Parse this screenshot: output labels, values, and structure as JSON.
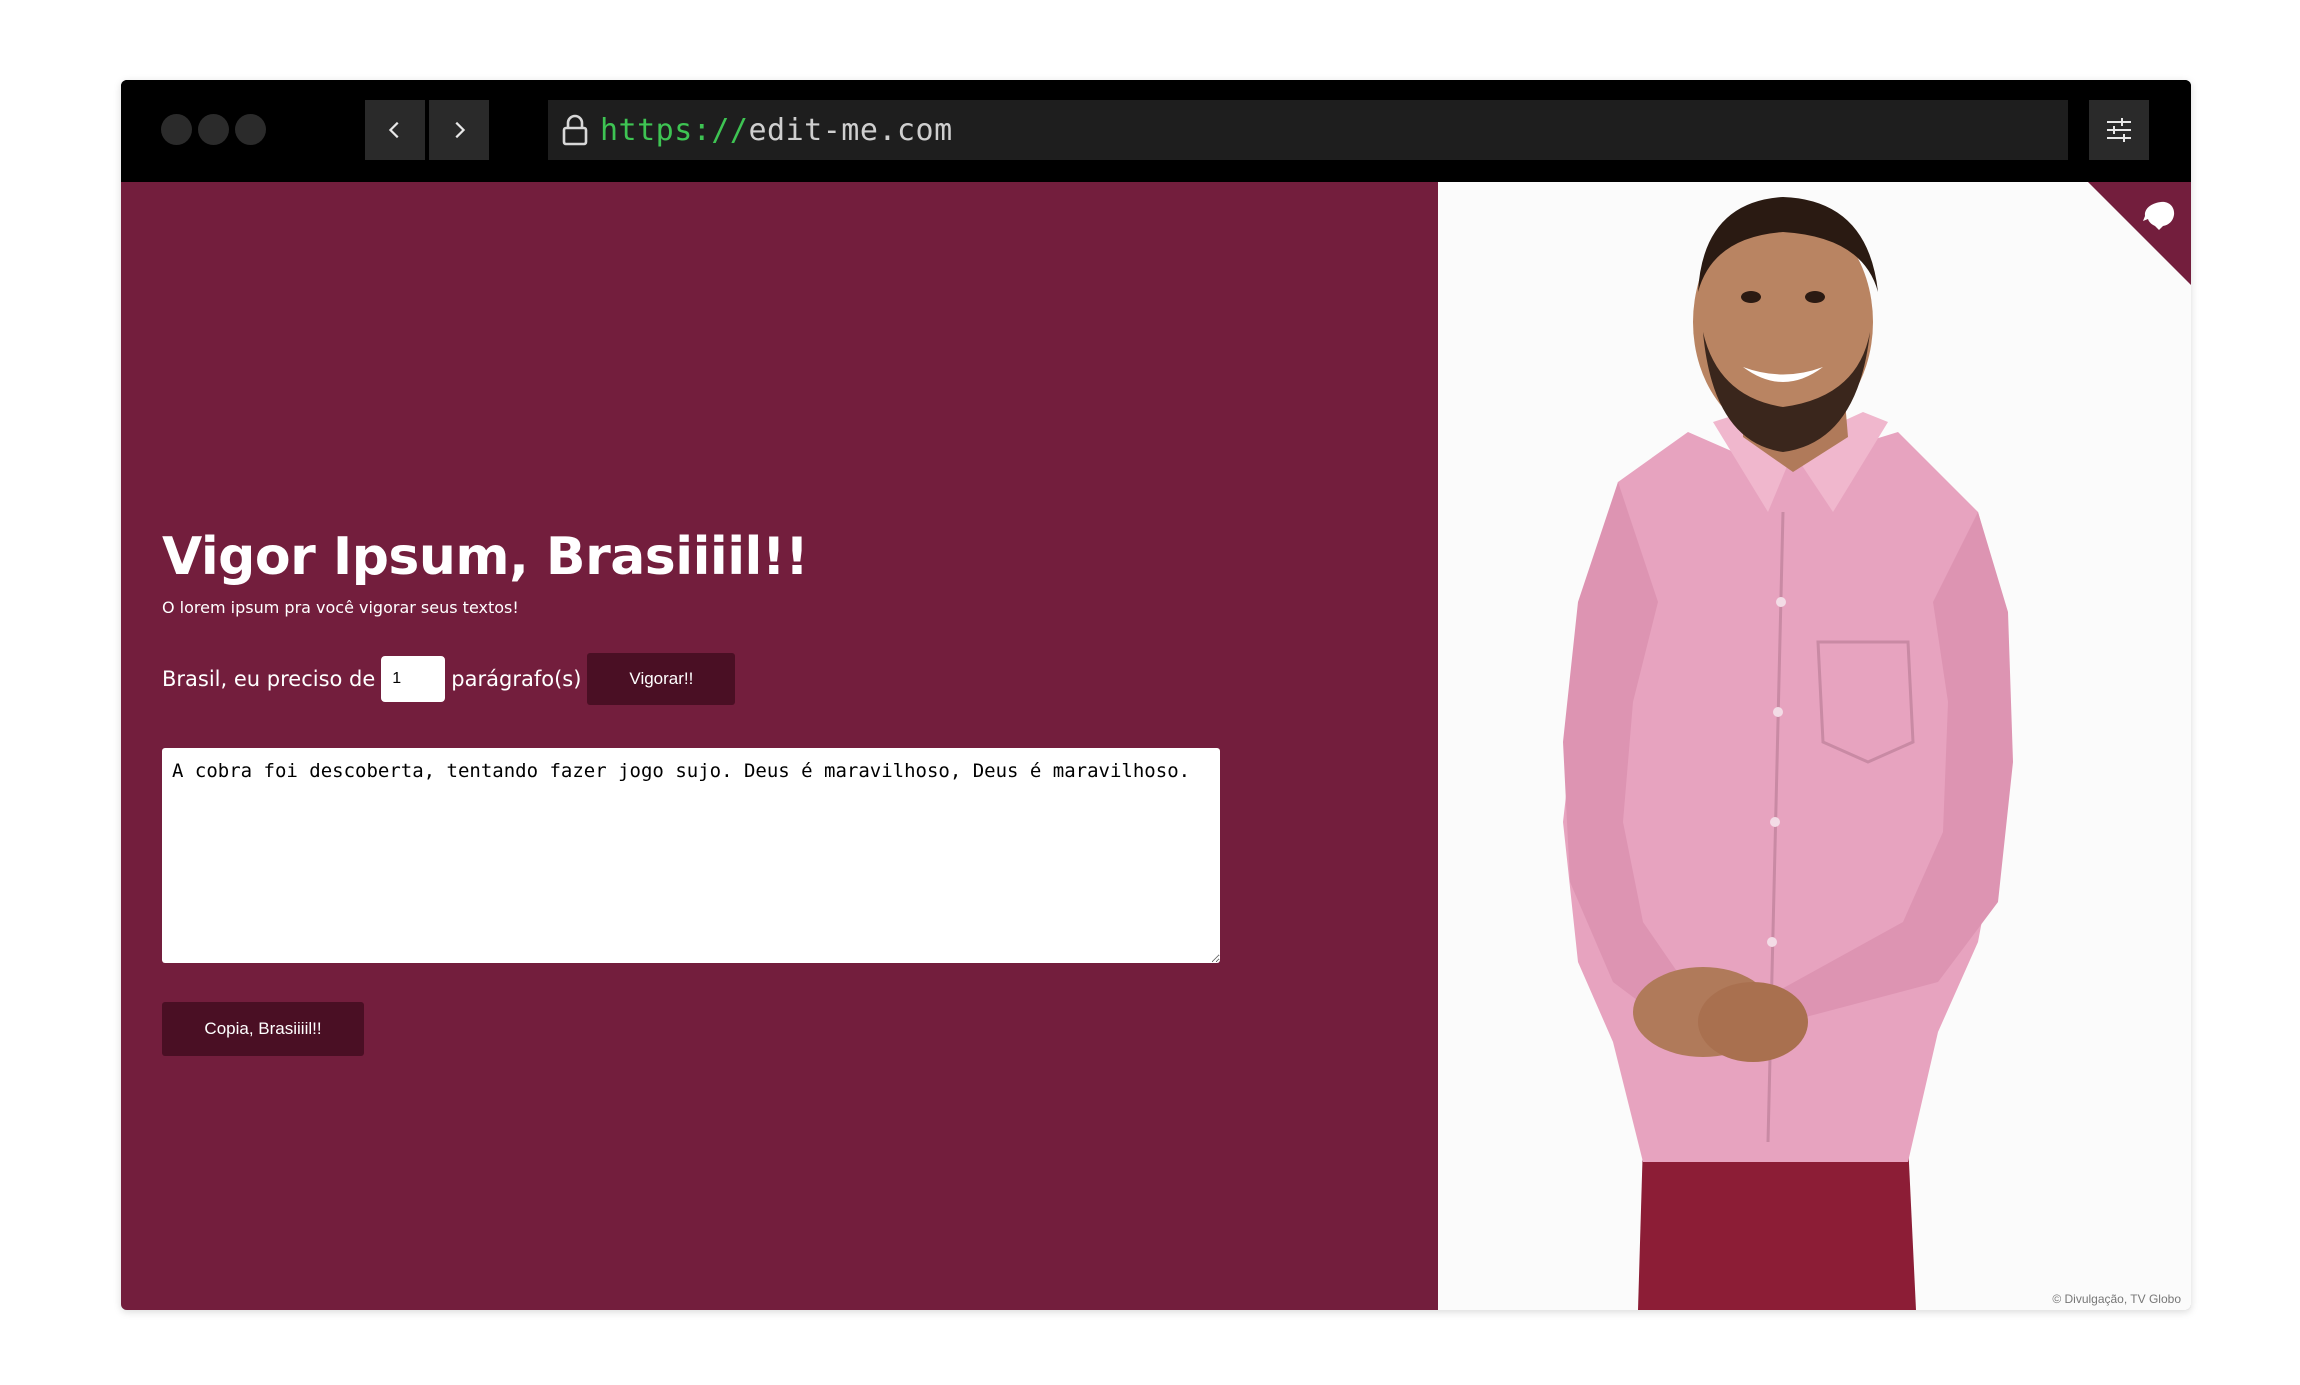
{
  "browser": {
    "url_scheme": "https://",
    "url_host": "edit-me.com"
  },
  "main": {
    "title": "Vigor Ipsum, Brasiiiil!!",
    "subtitle": "O lorem ipsum pra você vigorar seus textos!",
    "form": {
      "label_before": "Brasil, eu preciso de",
      "paragraph_count": "1",
      "label_after": "parágrafo(s)",
      "submit_label": "Vigorar!!"
    },
    "output_text": "A cobra foi descoberta, tentando fazer jogo sujo. Deus é maravilhoso, Deus é maravilhoso.",
    "copy_label": "Copia, Brasiiiil!!"
  },
  "photo": {
    "credit": "© Divulgação, TV Globo"
  },
  "colors": {
    "accent": "#731e3d",
    "button": "#4a0f24",
    "url_scheme": "#3ec453"
  },
  "icons": [
    "traffic-light-icon",
    "chevron-left-icon",
    "chevron-right-icon",
    "lock-icon",
    "settings-sliders-icon",
    "github-octocat-icon"
  ]
}
